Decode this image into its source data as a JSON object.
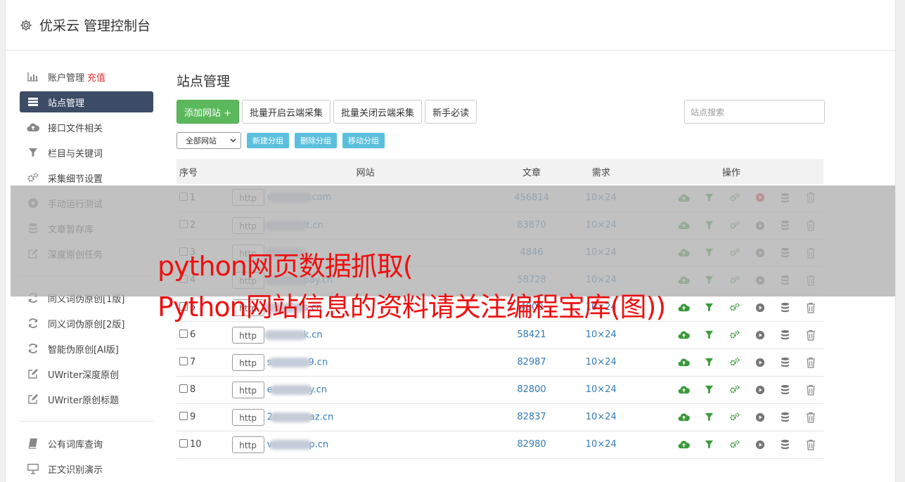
{
  "app": {
    "title": "优采云 管理控制台"
  },
  "sidebar": {
    "group1": [
      {
        "label": "账户管理",
        "extra": "充值",
        "icon": "bar-chart-icon"
      },
      {
        "label": "站点管理",
        "icon": "server-list-icon",
        "active": true
      },
      {
        "label": "接口文件相关",
        "icon": "cloud-upload-icon"
      },
      {
        "label": "栏目与关键词",
        "icon": "filter-icon"
      },
      {
        "label": "采集细节设置",
        "icon": "gears-icon"
      },
      {
        "label": "手动运行测试",
        "icon": "play-circle-icon"
      },
      {
        "label": "文章暂存库",
        "icon": "database-icon"
      },
      {
        "label": "深度原创任务",
        "icon": "edit-icon"
      }
    ],
    "group2": [
      {
        "label": "同义词伪原创[1版]",
        "icon": "refresh-icon"
      },
      {
        "label": "同义词伪原创[2版]",
        "icon": "refresh-icon"
      },
      {
        "label": "智能伪原创[AI版]",
        "icon": "refresh-icon"
      },
      {
        "label": "UWriter深度原创",
        "icon": "edit-icon"
      },
      {
        "label": "UWriter原创标题",
        "icon": "edit-icon"
      }
    ],
    "group3": [
      {
        "label": "公有词库查询",
        "icon": "book-icon"
      },
      {
        "label": "正文识别演示",
        "icon": "monitor-icon"
      }
    ]
  },
  "main": {
    "title": "站点管理",
    "buttons": {
      "add": "添加网站 +",
      "enable_cloud": "批量开启云端采集",
      "disable_cloud": "批量关闭云端采集",
      "guide": "新手必读"
    },
    "search_placeholder": "站点搜索",
    "group_select": "全部网站",
    "group_buttons": {
      "new": "新建分组",
      "delete": "删除分组",
      "move": "移动分组"
    },
    "table": {
      "headers": {
        "no": "序号",
        "site": "网站",
        "articles": "文章",
        "demand": "需求",
        "ops": "操作"
      },
      "rows": [
        {
          "no": "1",
          "protocol": "http",
          "prefix": "v",
          "suffix": ".com",
          "articles": "456814",
          "demand": "10×24",
          "running": true
        },
        {
          "no": "2",
          "protocol": "http",
          "prefix": "",
          "suffix": "lt.cn",
          "articles": "83870",
          "demand": "10×24",
          "running": false
        },
        {
          "no": "3",
          "protocol": "http",
          "prefix": "",
          "suffix": "",
          "articles": "4846",
          "demand": "10×24",
          "running": false
        },
        {
          "no": "4",
          "protocol": "http",
          "prefix": "",
          "suffix": "pay.cn",
          "articles": "58728",
          "demand": "10×24",
          "running": false
        },
        {
          "no": "5",
          "protocol": "http",
          "prefix": "",
          "suffix": "s.cn",
          "articles": "4900",
          "demand": "10×24",
          "running": false
        },
        {
          "no": "6",
          "protocol": "http",
          "prefix": "",
          "suffix": "k.cn",
          "articles": "58421",
          "demand": "10×24",
          "running": false
        },
        {
          "no": "7",
          "protocol": "http",
          "prefix": "s",
          "suffix": "9.cn",
          "articles": "82987",
          "demand": "10×24",
          "running": false
        },
        {
          "no": "8",
          "protocol": "http",
          "prefix": "e",
          "suffix": "y.cn",
          "articles": "82800",
          "demand": "10×24",
          "running": false
        },
        {
          "no": "9",
          "protocol": "http",
          "prefix": "2",
          "suffix": "az.cn",
          "articles": "82837",
          "demand": "10×24",
          "running": false
        },
        {
          "no": "10",
          "protocol": "http",
          "prefix": "v",
          "suffix": "p.cn",
          "articles": "82980",
          "demand": "10×24",
          "running": false
        }
      ]
    }
  },
  "watermark": {
    "line1": "python网页数据抓取(",
    "line2": "Python网站信息的资料请关注编程宝库(图))"
  },
  "colors": {
    "sidebar_active": "#3c4c66",
    "add_button": "#5cb85c",
    "group_button": "#5bc0de",
    "link": "#337ab7",
    "watermark": "#ee1010"
  }
}
